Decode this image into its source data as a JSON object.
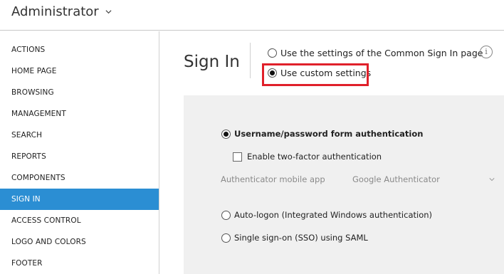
{
  "header": {
    "title": "Administrator",
    "dropdown_icon": "chevron-down-icon"
  },
  "sidebar": {
    "items": [
      {
        "label": "ACTIONS",
        "active": false
      },
      {
        "label": "HOME PAGE",
        "active": false
      },
      {
        "label": "BROWSING",
        "active": false
      },
      {
        "label": "MANAGEMENT",
        "active": false
      },
      {
        "label": "SEARCH",
        "active": false
      },
      {
        "label": "REPORTS",
        "active": false
      },
      {
        "label": "COMPONENTS",
        "active": false
      },
      {
        "label": "SIGN IN",
        "active": true
      },
      {
        "label": "ACCESS CONTROL",
        "active": false
      },
      {
        "label": "LOGO AND COLORS",
        "active": false
      },
      {
        "label": "FOOTER",
        "active": false
      }
    ],
    "active_color": "#2b8ed3"
  },
  "main": {
    "title": "Sign In",
    "settings_mode": {
      "common_label": "Use the settings of the Common Sign In page",
      "custom_label": "Use custom settings",
      "selected": "custom"
    },
    "info_icon": "info-icon",
    "info_glyph": "i",
    "highlight_color": "#e0202a",
    "auth": {
      "username_label": "Username/password form authentication",
      "username_selected": true,
      "two_factor_label": "Enable two-factor authentication",
      "two_factor_checked": false,
      "authenticator_label": "Authenticator mobile app",
      "authenticator_value": "Google Authenticator",
      "autologon_label": "Auto-logon (Integrated Windows authentication)",
      "sso_label": "Single sign-on (SSO) using SAML"
    }
  }
}
